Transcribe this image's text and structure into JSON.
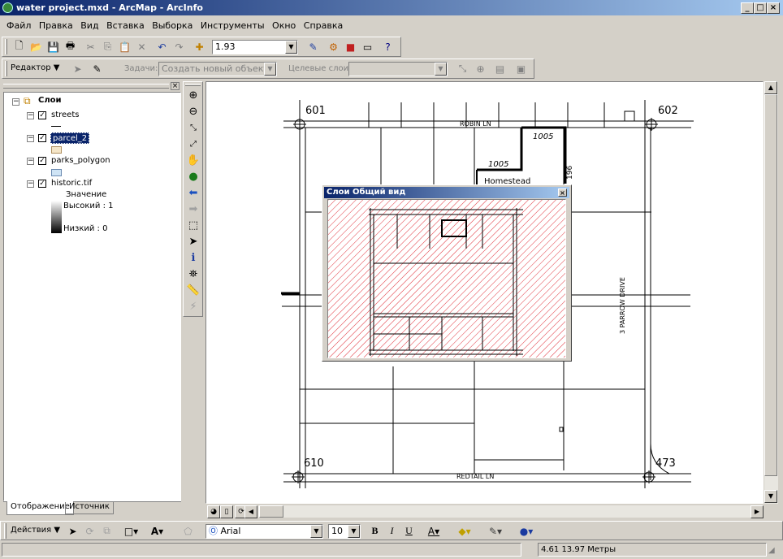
{
  "window": {
    "title": "water project.mxd - ArcMap - ArcInfo",
    "btn_min": "_",
    "btn_max": "□",
    "btn_close": "×"
  },
  "menu": {
    "items": [
      "Файл",
      "Правка",
      "Вид",
      "Вставка",
      "Выборка",
      "Инструменты",
      "Окно",
      "Справка"
    ]
  },
  "standard_toolbar": {
    "scale": "1.93",
    "dropdown_arrow": "▼"
  },
  "editor_toolbar": {
    "editor_label": "Редактор ▼",
    "task_label": "Задачи:",
    "task_value": "Создать новый объект",
    "target_label": "Целевые слои:",
    "target_value": ""
  },
  "toc": {
    "root": "Слои",
    "layers": [
      {
        "name": "streets",
        "checked": "✓"
      },
      {
        "name": "parcel_2",
        "checked": "✓"
      },
      {
        "name": "parks_polygon",
        "checked": "✓"
      },
      {
        "name": "historic.tif",
        "checked": "✓"
      }
    ],
    "raster_value_label": "Значение",
    "raster_high": "Высокий : 1",
    "raster_low": "Низкий : 0",
    "tab_display": "Отображение",
    "tab_source": "Источник",
    "expander": "−"
  },
  "map": {
    "labels": {
      "n601": "601",
      "n602": "602",
      "n610": "610",
      "n473": "473",
      "robin": "ROBIN LN",
      "redtail": "REDTAIL LN",
      "sparrow": "3 PARROW DRIVE",
      "p1005a": "1005",
      "p1005b": "1005",
      "homestead": "Homestead",
      "n196": "196"
    }
  },
  "overview": {
    "title": "Слои Общий вид",
    "close": "×"
  },
  "draw_toolbar": {
    "actions": "Действия ▼",
    "font": "Arial",
    "size": "10",
    "bold": "B",
    "italic": "I",
    "underline": "U"
  },
  "status": {
    "coords": "4.61  13.97 Метры"
  },
  "colors": {
    "title_start": "#0a246a",
    "title_end": "#a6caf0",
    "hatch": "#e0303a"
  }
}
